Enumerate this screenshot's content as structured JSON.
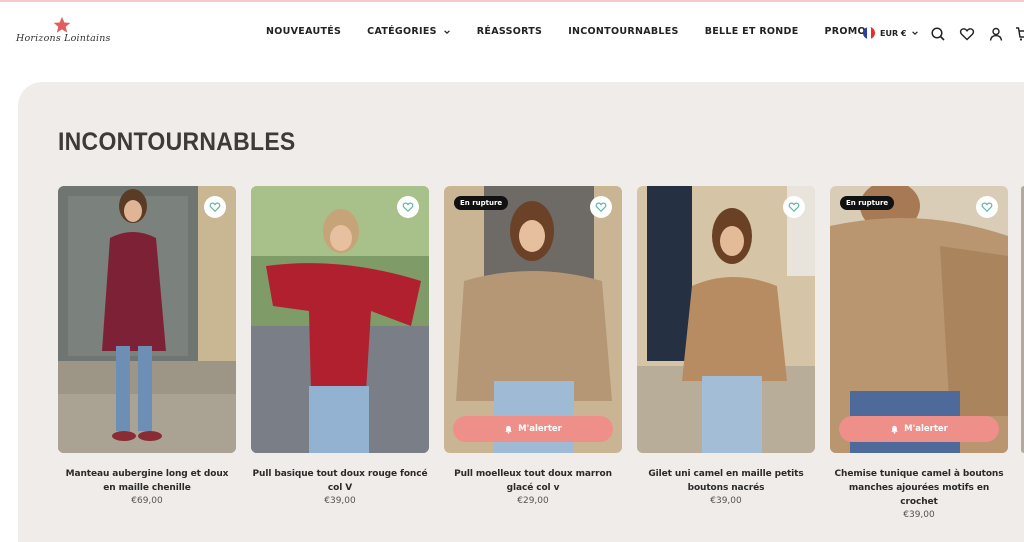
{
  "brand": {
    "logo_text": "Horizons Lointains"
  },
  "nav": {
    "items": [
      {
        "label": "NOUVEAUTÉS"
      },
      {
        "label": "CATÉGORIES",
        "has_dropdown": true
      },
      {
        "label": "RÉASSORTS"
      },
      {
        "label": "INCONTOURNABLES"
      },
      {
        "label": "BELLE ET RONDE"
      },
      {
        "label": "PROMOS"
      }
    ]
  },
  "header_actions": {
    "currency": "EUR €",
    "icons": [
      "search-icon",
      "heart-icon",
      "account-icon",
      "cart-icon"
    ]
  },
  "section": {
    "title": "INCONTOURNABLES"
  },
  "colors": {
    "accent": "#ee8f8a",
    "background": "#efecea",
    "badge": "#111111",
    "wishlist_heart": "#5fb7a6"
  },
  "products": [
    {
      "title": "Manteau aubergine long et doux en maille chenille",
      "price": "€69,00",
      "badge": "",
      "alert_label": ""
    },
    {
      "title": "Pull basique tout doux rouge foncé col V",
      "price": "€39,00",
      "badge": "",
      "alert_label": ""
    },
    {
      "title": "Pull moelleux tout doux marron glacé col v",
      "price": "€29,00",
      "badge": "En rupture",
      "alert_label": "M'alerter"
    },
    {
      "title": "Gilet uni camel en maille petits boutons nacrés",
      "price": "€39,00",
      "badge": "",
      "alert_label": ""
    },
    {
      "title": "Chemise tunique camel à boutons manches ajourées motifs en crochet",
      "price": "€39,00",
      "badge": "En rupture",
      "alert_label": "M'alerter"
    }
  ]
}
